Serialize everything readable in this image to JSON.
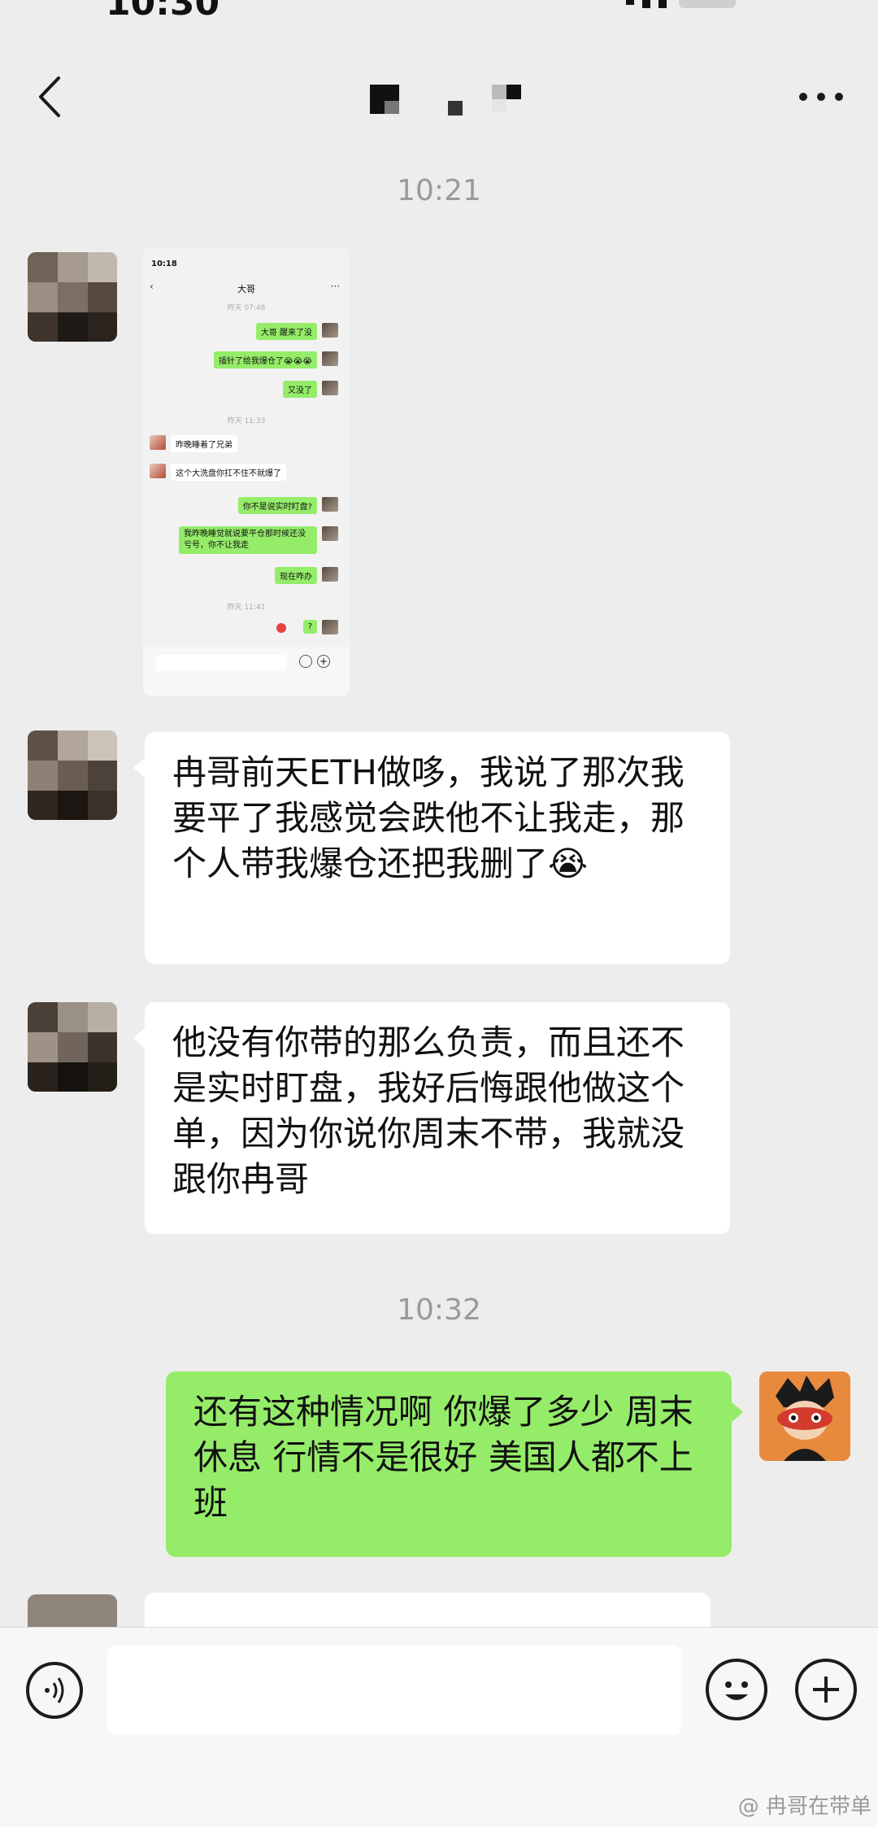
{
  "header": {
    "back_icon": "chevron-left-icon",
    "more_icon": "ellipsis-icon"
  },
  "timestamps": [
    "10:21",
    "10:32"
  ],
  "embedded_screenshot": {
    "status_time": "10:18",
    "title": "大哥",
    "entries": [
      {
        "kind": "time",
        "text": "昨天 07:48"
      },
      {
        "kind": "out",
        "text": "大哥 醒来了没"
      },
      {
        "kind": "out",
        "text": "插针了给我爆仓了😭😭😭"
      },
      {
        "kind": "out",
        "text": "又没了"
      },
      {
        "kind": "time",
        "text": "昨天 11:33"
      },
      {
        "kind": "in",
        "text": "昨晚睡着了兄弟"
      },
      {
        "kind": "in",
        "text": "这个大洗盘你扛不住不就爆了"
      },
      {
        "kind": "out",
        "text": "你不是说实时盯盘?"
      },
      {
        "kind": "out",
        "text": "我昨晚睡觉就说要平仓那时候还没亏号，你不让我走"
      },
      {
        "kind": "out",
        "text": "现在咋办"
      },
      {
        "kind": "time",
        "text": "昨天 11:41"
      },
      {
        "kind": "out",
        "text": "?"
      }
    ]
  },
  "messages": [
    {
      "side": "in",
      "text": "冉哥前天ETH做哆，我说了那次我要平了我感觉会跌他不让我走，那个人带我爆仓还把我删了😭"
    },
    {
      "side": "in",
      "text": "他没有你带的那么负责，而且还不是实时盯盘，我好后悔跟他做这个单，因为你说你周末不带，我就没跟你冉哥"
    },
    {
      "side": "out",
      "text": "还有这种情况啊 你爆了多少 周末休息 行情不是很好 美国人都不上班"
    }
  ],
  "input_bar": {
    "voice_icon": "voice-icon",
    "emoji_icon": "emoji-icon",
    "plus_icon": "plus-icon",
    "input_value": ""
  },
  "watermark": "@ 冉哥在带单",
  "colors": {
    "background": "#ededed",
    "incoming_bubble": "#ffffff",
    "outgoing_bubble": "#95ec69",
    "timestamp": "#9a9a9a"
  }
}
